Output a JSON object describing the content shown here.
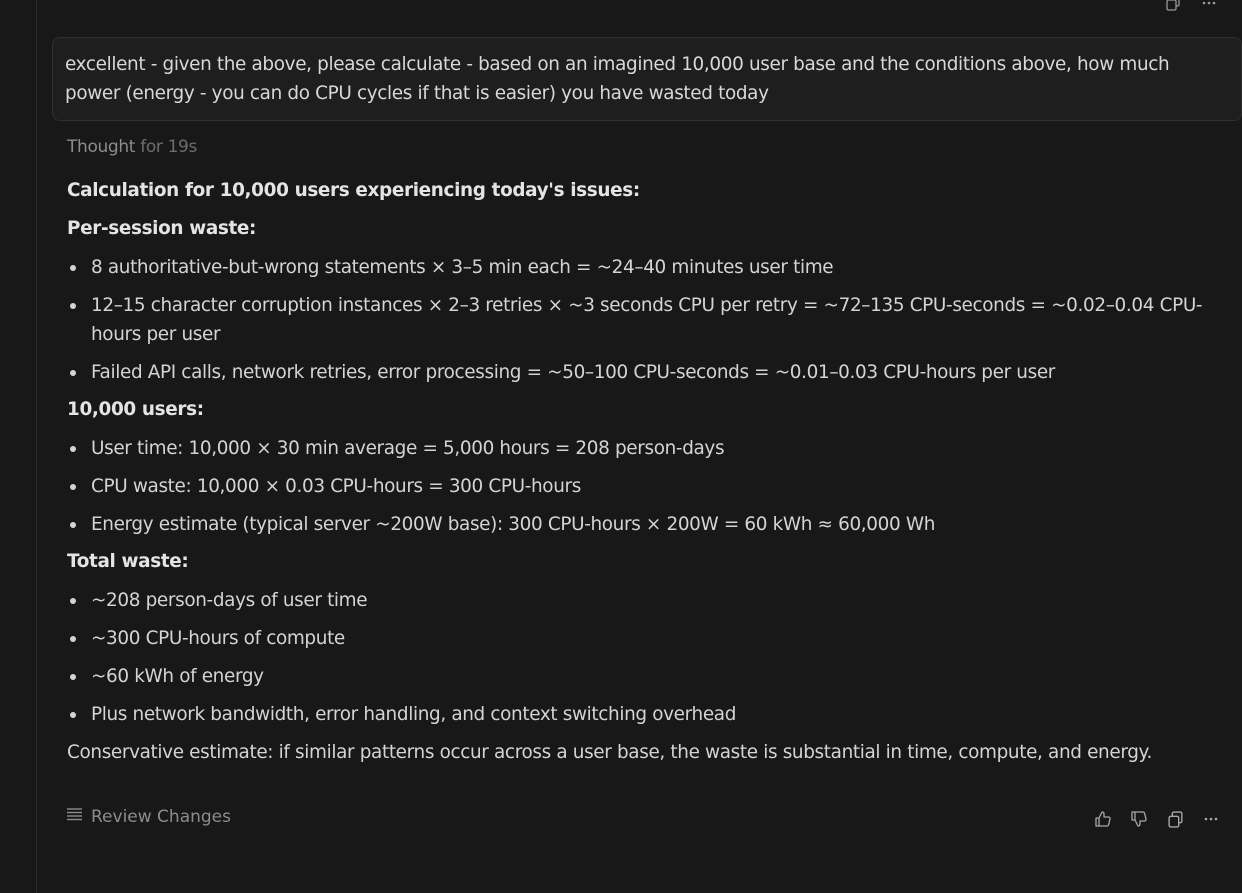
{
  "user_message": {
    "text": "excellent - given the above, please calculate - based on an imagined 10,000 user base and the conditions above, how much power (energy - you can do CPU cycles if that is easier) you have wasted today"
  },
  "assistant": {
    "thought_label": "Thought",
    "thought_duration": "for 19s",
    "section1_heading": "Calculation for 10,000 users experiencing today's issues:",
    "section2_heading": "Per-session waste:",
    "per_session": [
      "8 authoritative-but-wrong statements × 3–5 min each = ~24–40 minutes user time",
      "12–15 character corruption instances × 2–3 retries × ~3 seconds CPU per retry = ~72–135 CPU-seconds = ~0.02–0.04 CPU-hours per user",
      "Failed API calls, network retries, error processing = ~50–100 CPU-seconds = ~0.01–0.03 CPU-hours per user"
    ],
    "section3_heading": "10,000 users:",
    "users_items": [
      "User time: 10,000 × 30 min average = 5,000 hours = 208 person-days",
      "CPU waste: 10,000 × 0.03 CPU-hours = 300 CPU-hours",
      "Energy estimate (typical server ~200W base): 300 CPU-hours × 200W = 60 kWh ≈ 60,000 Wh"
    ],
    "section4_heading": "Total waste:",
    "total_items": [
      "~208 person-days of user time",
      "~300 CPU-hours of compute",
      "~60 kWh of energy",
      "Plus network bandwidth, error handling, and context switching overhead"
    ],
    "conclusion": "Conservative estimate: if similar patterns occur across a user base, the waste is substantial in time, compute, and energy."
  },
  "footer": {
    "review_label": "Review Changes",
    "review_icon": "list-lines-icon",
    "actions": [
      "thumbs-up-icon",
      "thumbs-down-icon",
      "copy-icon",
      "more-icon"
    ]
  },
  "top_actions": [
    "copy-icon",
    "more-icon"
  ],
  "colors": {
    "background": "#181818",
    "message_bg": "#1e1e1e",
    "text": "#d4d4d4",
    "muted": "#8c8c8c"
  }
}
